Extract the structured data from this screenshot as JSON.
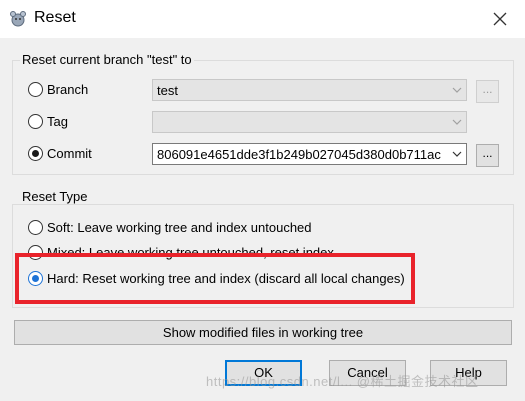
{
  "window": {
    "title": "Reset",
    "app_icon": "reset-app-icon",
    "close_icon": "close-icon"
  },
  "reset_target": {
    "group_title": "Reset current branch \"test\" to",
    "branch": {
      "label": "Branch",
      "value": "test"
    },
    "tag": {
      "label": "Tag",
      "value": ""
    },
    "commit": {
      "label": "Commit",
      "value": "806091e4651dde3f1b249b027045d380d0b711ac"
    },
    "browse_label": "..."
  },
  "reset_type": {
    "group_title": "Reset Type",
    "soft": "Soft: Leave working tree and index untouched",
    "mixed": "Mixed: Leave working tree untouched, reset index",
    "hard": "Hard: Reset working tree and index (discard all local changes)",
    "selected": "hard",
    "highlight_color": "#e9232b"
  },
  "buttons": {
    "show_modified": "Show modified files in working tree",
    "ok": "OK",
    "cancel": "Cancel",
    "help": "Help"
  },
  "watermark": "https://blog.csdn.net/l...  @稀土掘金技术社区"
}
